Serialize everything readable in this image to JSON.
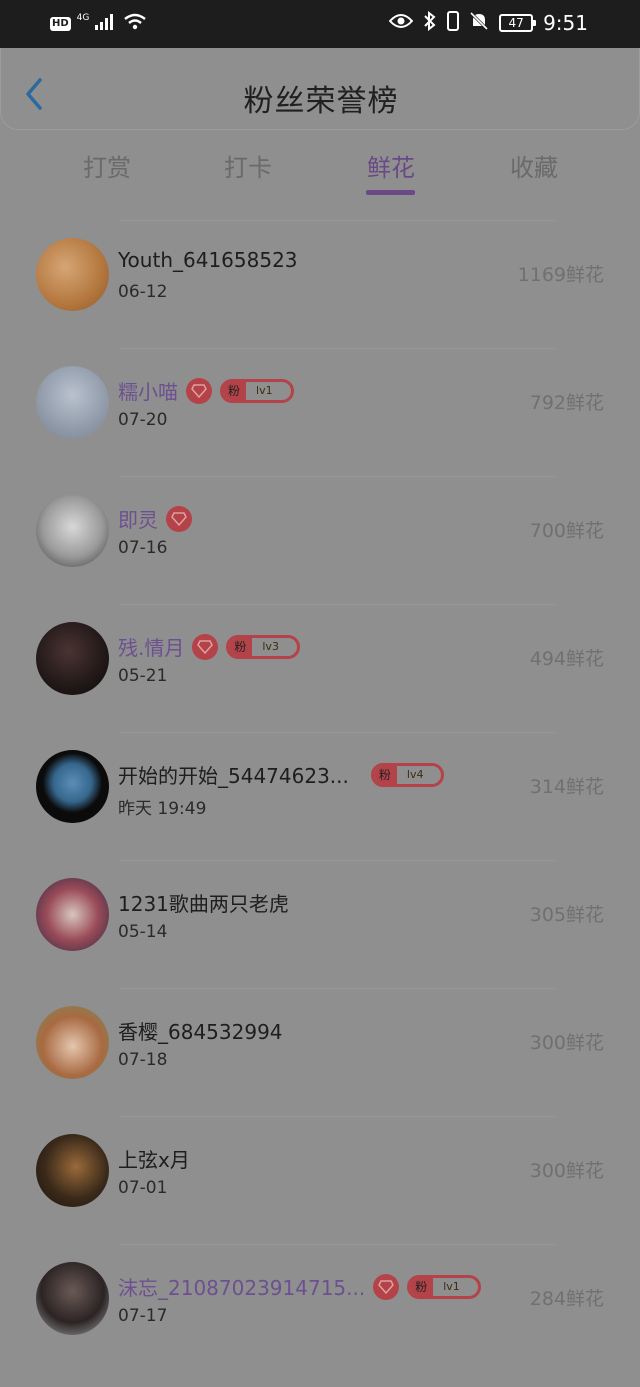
{
  "status": {
    "hd": "HD",
    "network": "4G",
    "battery": "47",
    "time": "9:51"
  },
  "header": {
    "title": "粉丝荣誉榜"
  },
  "tabs": [
    {
      "label": "打赏",
      "active": false
    },
    {
      "label": "打卡",
      "active": false
    },
    {
      "label": "鲜花",
      "active": true
    },
    {
      "label": "收藏",
      "active": false
    }
  ],
  "rows": [
    {
      "name": "Youth_641658523",
      "date": "06-12",
      "count": "1169鲜花",
      "vip": false,
      "gem": false,
      "fan": ""
    },
    {
      "name": "糯小喵",
      "date": "07-20",
      "count": "792鲜花",
      "vip": true,
      "gem": true,
      "fan_prefix": "粉",
      "fan": "lv1"
    },
    {
      "name": "即灵",
      "date": "07-16",
      "count": "700鲜花",
      "vip": true,
      "gem": true,
      "fan": ""
    },
    {
      "name": "残.情月",
      "date": "05-21",
      "count": "494鲜花",
      "vip": true,
      "gem": true,
      "fan_prefix": "粉",
      "fan": "lv3"
    },
    {
      "name": "开始的开始_54474623...",
      "date": "昨天 19:49",
      "count": "314鲜花",
      "vip": false,
      "gem": false,
      "fan_prefix": "粉",
      "fan": "lv4"
    },
    {
      "name": "1231歌曲两只老虎",
      "date": "05-14",
      "count": "305鲜花",
      "vip": false,
      "gem": false,
      "fan": ""
    },
    {
      "name": "香樱_684532994",
      "date": "07-18",
      "count": "300鲜花",
      "vip": false,
      "gem": false,
      "fan": ""
    },
    {
      "name": "上弦x月",
      "date": "07-01",
      "count": "300鲜花",
      "vip": false,
      "gem": false,
      "fan": ""
    },
    {
      "name": "沫忘_21087023914715...",
      "date": "07-17",
      "count": "284鲜花",
      "vip": true,
      "gem": true,
      "fan_prefix": "粉",
      "fan": "lv1"
    }
  ],
  "colors": {
    "accent": "#6a4a86",
    "badge": "#b34348",
    "overlay_bg": "#8f8f8f"
  }
}
